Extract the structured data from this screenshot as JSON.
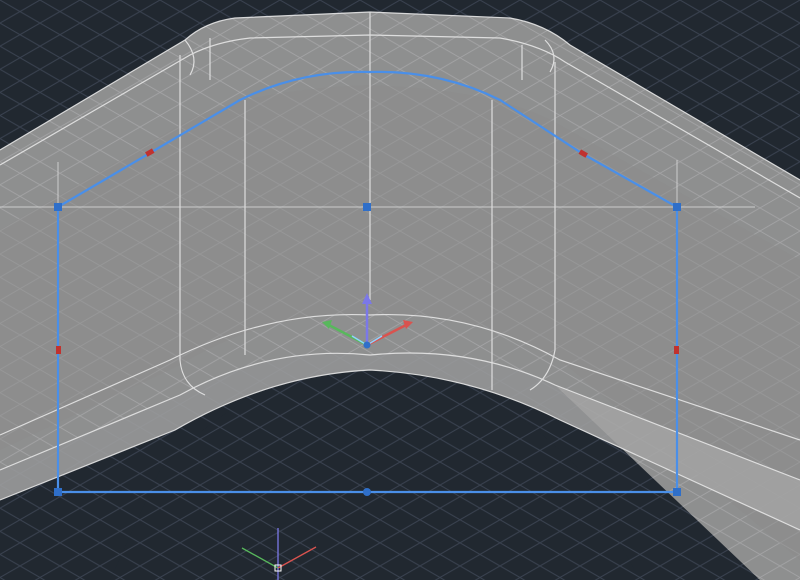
{
  "app": {
    "name": "3D CAD viewport",
    "view": "isometric"
  },
  "colors": {
    "background": "#212830",
    "grid": "#3a4250",
    "solid_fill": "#9a9a9a",
    "solid_edge": "#e6e6e6",
    "selection": "#4a8fe8",
    "grip": "#2f6fc9",
    "midpoint_marker": "#c0322f",
    "gizmo_x": "#d9534f",
    "gizmo_y": "#58b85c",
    "gizmo_z": "#7b78e8"
  },
  "selection": {
    "type": "polyline-profile",
    "is_selected": true,
    "grip_count": 6,
    "midpoint_marker_count": 4
  },
  "icons": {
    "gizmo": "move-gizmo-icon",
    "ucs": "ucs-icon",
    "crosshair": "crosshair-icon"
  }
}
